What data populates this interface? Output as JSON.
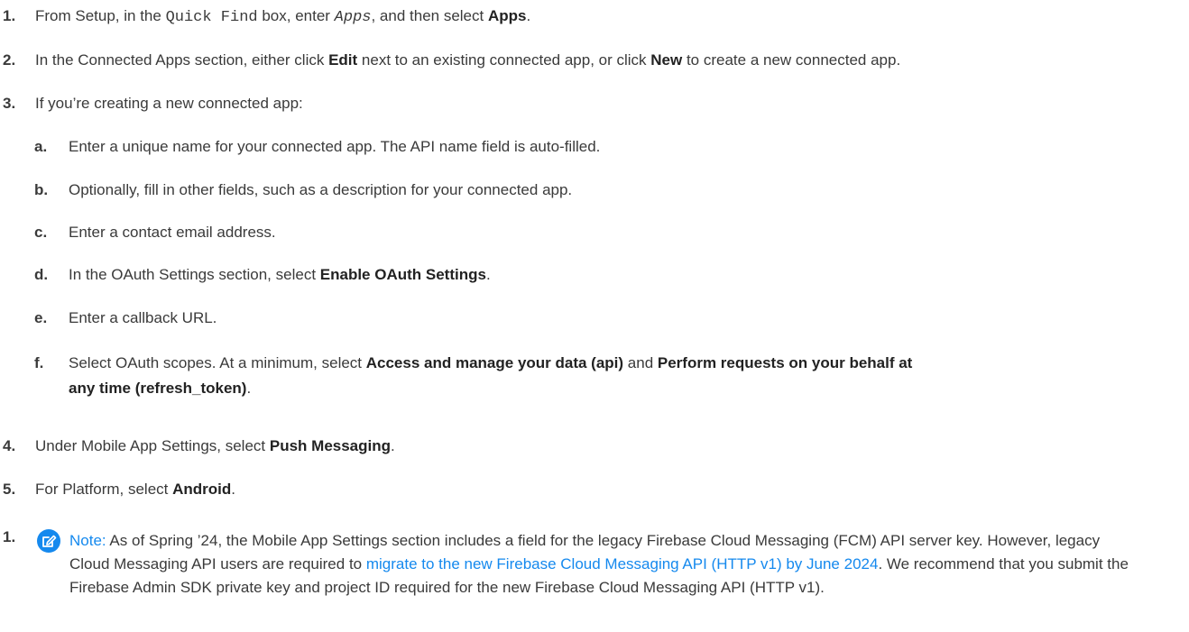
{
  "steps": [
    {
      "num": "1.",
      "parts": {
        "a": "From Setup, in the ",
        "code": "Quick Find",
        "b": " box, enter ",
        "code_italic": "Apps",
        "c": ", and then select ",
        "bold": "Apps",
        "d": "."
      }
    },
    {
      "num": "2.",
      "parts": {
        "a": "In the Connected Apps section, either click ",
        "bold1": "Edit",
        "b": " next to an existing connected app, or click ",
        "bold2": "New",
        "c": " to create a new connected app."
      }
    },
    {
      "num": "3.",
      "text": "If you’re creating a new connected app:"
    },
    {
      "num": "4.",
      "parts": {
        "a": "Under Mobile App Settings, select ",
        "bold": "Push Messaging",
        "b": "."
      }
    },
    {
      "num": "5.",
      "parts": {
        "a": "For Platform, select ",
        "bold": "Android",
        "b": "."
      }
    }
  ],
  "substeps": [
    {
      "letter": "a.",
      "text": "Enter a unique name for your connected app. The API name field is auto-filled."
    },
    {
      "letter": "b.",
      "text": "Optionally, fill in other fields, such as a description for your connected app."
    },
    {
      "letter": "c.",
      "text": "Enter a contact email address."
    },
    {
      "letter": "d.",
      "parts": {
        "a": "In the OAuth Settings section, select ",
        "bold": "Enable OAuth Settings",
        "b": "."
      }
    },
    {
      "letter": "e.",
      "text": "Enter a callback URL."
    },
    {
      "letter": "f.",
      "parts": {
        "a": "Select OAuth scopes. At a minimum, select ",
        "bold1": "Access and manage your data (api)",
        "b": " and ",
        "bold2_line1": "Perform requests on your behalf at",
        "bold2_line2": "any time (refresh_token)",
        "c": "."
      }
    }
  ],
  "note": {
    "num": "1.",
    "icon": "note-edit-icon",
    "label": "Note:",
    "text_a": " As of Spring ’24, the Mobile App Settings section includes a field for the legacy Firebase Cloud Messaging (FCM) API server key. However, legacy Cloud Messaging API users are required to ",
    "link": "migrate to the new Firebase Cloud Messaging API (HTTP v1) by June 2024",
    "text_b": ". We recommend that you submit the Firebase Admin SDK private key and project ID required for the new Firebase Cloud Messaging API (HTTP v1).",
    "accent_color": "#1589ee"
  }
}
